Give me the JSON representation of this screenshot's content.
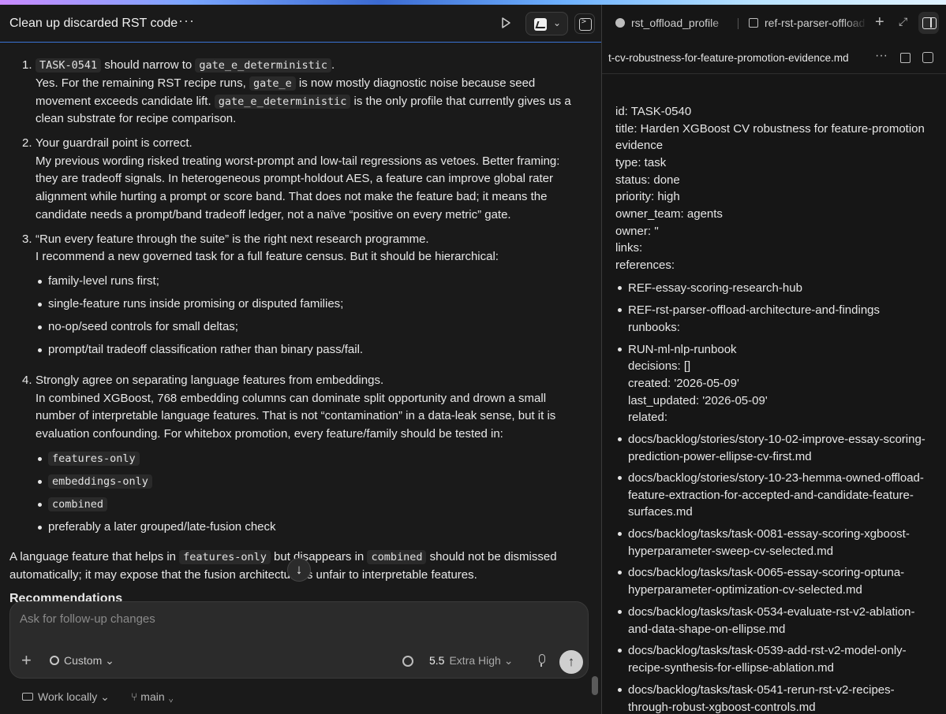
{
  "header": {
    "conversation_title": "Clean up discarded RST code",
    "more_icon": "ellipsis-icon",
    "run_icon": "play-icon"
  },
  "response": {
    "item1": {
      "number": "1.",
      "code_task": "TASK-0541",
      "line1_mid": "should narrow to",
      "code_gate_det": "gate_e_deterministic",
      "line1_end": ".",
      "line2_a": "Yes. For the remaining RST recipe runs,",
      "code_gate_e": "gate_e",
      "line2_b": "is now mostly diagnostic noise because seed",
      "line3_a": "movement exceeds candidate lift.",
      "code_gate_det2": "gate_e_deterministic",
      "line3_b": "is the only profile that currently gives us a",
      "line4": "clean substrate for recipe comparison."
    },
    "item2": {
      "number": "2.",
      "lines": [
        "Your guardrail point is correct.",
        "My previous wording risked treating worst-prompt and low-tail regressions as vetoes. Better framing:",
        "they are tradeoff signals. In heterogeneous prompt-holdout AES, a feature can improve global rater",
        "alignment while hurting a prompt or score band. That does not make the feature bad; it means the",
        "candidate needs a prompt/band tradeoff ledger, not a naïve “positive on every metric” gate."
      ]
    },
    "item3": {
      "number": "3.",
      "lines": [
        "“Run every feature through the suite” is the right next research programme.",
        "I recommend a new governed task for a full feature census. But it should be hierarchical:"
      ],
      "bullets": [
        "family-level runs first;",
        "single-feature runs inside promising or disputed families;",
        "no-op/seed controls for small deltas;",
        "prompt/tail tradeoff classification rather than binary pass/fail."
      ]
    },
    "item4": {
      "number": "4.",
      "lines": [
        "Strongly agree on separating language features from embeddings.",
        "In combined XGBoost, 768 embedding columns can dominate split opportunity and drown a small",
        "number of interpretable language features. That is not “contamination” in a data-leak sense, but it is",
        "evaluation confounding. For whitebox promotion, every feature/family should be tested in:"
      ],
      "code_bullets": [
        "features-only",
        "embeddings-only",
        "combined"
      ],
      "last_bullet": "preferably a later grouped/late-fusion check"
    },
    "closing": {
      "a": "A language feature that helps in",
      "code1": "features-only",
      "b": "but disappears in",
      "code2": "combined",
      "c": "should not be dismissed",
      "line2": "automatically; it may expose that the fusion architecture is unfair to interpretable features."
    },
    "recommendations_heading": "Recommendations"
  },
  "composer": {
    "placeholder": "Ask for follow-up changes",
    "mode": "Custom",
    "model_version": "5.5",
    "effort": "Extra High"
  },
  "footer": {
    "work_mode": "Work locally",
    "branch": "main"
  },
  "right_panel": {
    "tabs": [
      "rst_offload_profile",
      "ref-rst-parser-offload"
    ],
    "file_name": "t-cv-robustness-for-feature-promotion-evidence.md",
    "doc_lines": [
      "id: TASK-0540",
      "title: Harden XGBoost CV robustness for feature-promotion",
      "evidence",
      "type: task",
      "status: done",
      "priority: high",
      "owner_team: agents",
      "owner: ''",
      "links:",
      "references:"
    ],
    "references": [
      "REF-essay-scoring-research-hub",
      "REF-rst-parser-offload-architecture-and-findings"
    ],
    "runbooks_label": "runbooks:",
    "runbook_item": "RUN-ml-nlp-runbook",
    "meta_lines": [
      "decisions: []",
      "created: '2026-05-09'",
      "last_updated: '2026-05-09'",
      "related:"
    ],
    "related": [
      "docs/backlog/stories/story-10-02-improve-essay-scoring-prediction-power-ellipse-cv-first.md",
      "docs/backlog/stories/story-10-23-hemma-owned-offload-feature-extraction-for-accepted-and-candidate-feature-surfaces.md",
      "docs/backlog/tasks/task-0081-essay-scoring-xgboost-hyperparameter-sweep-cv-selected.md",
      "docs/backlog/tasks/task-0065-essay-scoring-optuna-hyperparameter-optimization-cv-selected.md",
      "docs/backlog/tasks/task-0534-evaluate-rst-v2-ablation-and-data-shape-on-ellipse.md",
      "docs/backlog/tasks/task-0539-add-rst-v2-model-only-recipe-synthesis-for-ellipse-ablation.md",
      "docs/backlog/tasks/task-0541-rerun-rst-v2-recipes-through-robust-xgboost-controls.md"
    ]
  }
}
